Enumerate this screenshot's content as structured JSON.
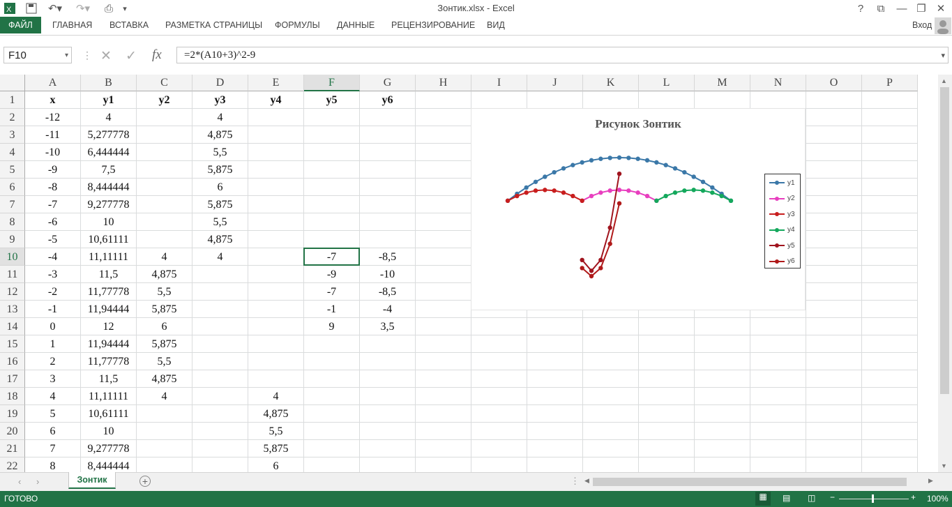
{
  "window": {
    "title": "Зонтик.xlsx - Excel",
    "help": "?",
    "controls": [
      "⧉",
      "—",
      "❐",
      "✕"
    ]
  },
  "ribbon": {
    "file_tab": "ФАЙЛ",
    "tabs": [
      "ГЛАВНАЯ",
      "ВСТАВКА",
      "РАЗМЕТКА СТРАНИЦЫ",
      "ФОРМУЛЫ",
      "ДАННЫЕ",
      "РЕЦЕНЗИРОВАНИЕ",
      "ВИД"
    ],
    "signin": "Вход"
  },
  "formula_bar": {
    "name_box": "F10",
    "formula": "=2*(A10+3)^2-9",
    "fx_label": "fx"
  },
  "sheet": {
    "columns": [
      "A",
      "B",
      "C",
      "D",
      "E",
      "F",
      "G",
      "H",
      "I",
      "J",
      "K",
      "L",
      "M",
      "N",
      "O",
      "P"
    ],
    "selected_cell": "F10",
    "rows": [
      {
        "n": "1",
        "c": [
          "x",
          "y1",
          "y2",
          "y3",
          "y4",
          "y5",
          "y6"
        ]
      },
      {
        "n": "2",
        "c": [
          "-12",
          "4",
          "",
          "4",
          "",
          "",
          ""
        ]
      },
      {
        "n": "3",
        "c": [
          "-11",
          "5,277778",
          "",
          "4,875",
          "",
          "",
          ""
        ]
      },
      {
        "n": "4",
        "c": [
          "-10",
          "6,444444",
          "",
          "5,5",
          "",
          "",
          ""
        ]
      },
      {
        "n": "5",
        "c": [
          "-9",
          "7,5",
          "",
          "5,875",
          "",
          "",
          ""
        ]
      },
      {
        "n": "6",
        "c": [
          "-8",
          "8,444444",
          "",
          "6",
          "",
          "",
          ""
        ]
      },
      {
        "n": "7",
        "c": [
          "-7",
          "9,277778",
          "",
          "5,875",
          "",
          "",
          ""
        ]
      },
      {
        "n": "8",
        "c": [
          "-6",
          "10",
          "",
          "5,5",
          "",
          "",
          ""
        ]
      },
      {
        "n": "9",
        "c": [
          "-5",
          "10,61111",
          "",
          "4,875",
          "",
          "",
          ""
        ]
      },
      {
        "n": "10",
        "c": [
          "-4",
          "11,11111",
          "4",
          "4",
          "",
          "-7",
          "-8,5"
        ]
      },
      {
        "n": "11",
        "c": [
          "-3",
          "11,5",
          "4,875",
          "",
          "",
          "-9",
          "-10"
        ]
      },
      {
        "n": "12",
        "c": [
          "-2",
          "11,77778",
          "5,5",
          "",
          "",
          "-7",
          "-8,5"
        ]
      },
      {
        "n": "13",
        "c": [
          "-1",
          "11,94444",
          "5,875",
          "",
          "",
          "-1",
          "-4"
        ]
      },
      {
        "n": "14",
        "c": [
          "0",
          "12",
          "6",
          "",
          "",
          "9",
          "3,5"
        ]
      },
      {
        "n": "15",
        "c": [
          "1",
          "11,94444",
          "5,875",
          "",
          "",
          "",
          ""
        ]
      },
      {
        "n": "16",
        "c": [
          "2",
          "11,77778",
          "5,5",
          "",
          "",
          "",
          ""
        ]
      },
      {
        "n": "17",
        "c": [
          "3",
          "11,5",
          "4,875",
          "",
          "",
          "",
          ""
        ]
      },
      {
        "n": "18",
        "c": [
          "4",
          "11,11111",
          "4",
          "",
          "4",
          "",
          ""
        ]
      },
      {
        "n": "19",
        "c": [
          "5",
          "10,61111",
          "",
          "",
          "4,875",
          "",
          ""
        ]
      },
      {
        "n": "20",
        "c": [
          "6",
          "10",
          "",
          "",
          "5,5",
          "",
          ""
        ]
      },
      {
        "n": "21",
        "c": [
          "7",
          "9,277778",
          "",
          "",
          "5,875",
          "",
          ""
        ]
      },
      {
        "n": "22",
        "c": [
          "8",
          "8,444444",
          "",
          "",
          "6",
          "",
          ""
        ]
      }
    ]
  },
  "chart_data": {
    "type": "scatter",
    "title": "Рисунок   Зонтик",
    "legend_position": "right",
    "xlim": [
      -12,
      12
    ],
    "ylim": [
      -10,
      12
    ],
    "series": [
      {
        "name": "y1",
        "color": "#3b78a8",
        "x": [
          -12,
          -11,
          -10,
          -9,
          -8,
          -7,
          -6,
          -5,
          -4,
          -3,
          -2,
          -1,
          0,
          1,
          2,
          3,
          4,
          5,
          6,
          7,
          8,
          9,
          10,
          11,
          12
        ],
        "y": [
          4,
          5.277778,
          6.444444,
          7.5,
          8.444444,
          9.277778,
          10,
          10.61111,
          11.11111,
          11.5,
          11.77778,
          11.94444,
          12,
          11.94444,
          11.77778,
          11.5,
          11.11111,
          10.61111,
          10,
          9.277778,
          8.444444,
          7.5,
          6.444444,
          5.277778,
          4
        ]
      },
      {
        "name": "y2",
        "color": "#e83fbf",
        "x": [
          -4,
          -3,
          -2,
          -1,
          0,
          1,
          2,
          3,
          4
        ],
        "y": [
          4,
          4.875,
          5.5,
          5.875,
          6,
          5.875,
          5.5,
          4.875,
          4
        ]
      },
      {
        "name": "y3",
        "color": "#c81e1e",
        "x": [
          -12,
          -11,
          -10,
          -9,
          -8,
          -7,
          -6,
          -5,
          -4
        ],
        "y": [
          4,
          4.875,
          5.5,
          5.875,
          6,
          5.875,
          5.5,
          4.875,
          4
        ]
      },
      {
        "name": "y4",
        "color": "#14a85c",
        "x": [
          4,
          5,
          6,
          7,
          8,
          9,
          10,
          11,
          12
        ],
        "y": [
          4,
          4.875,
          5.5,
          5.875,
          6,
          5.875,
          5.5,
          4.875,
          4
        ]
      },
      {
        "name": "y5",
        "color": "#a0141e",
        "x": [
          -4,
          -3,
          -2,
          -1,
          0
        ],
        "y": [
          -7,
          -9,
          -7,
          -1,
          9
        ]
      },
      {
        "name": "y6",
        "color": "#b01a1a",
        "x": [
          -4,
          -3,
          -2,
          -1,
          0
        ],
        "y": [
          -8.5,
          -10,
          -8.5,
          -4,
          3.5
        ]
      }
    ]
  },
  "sheet_tabs": {
    "active": "Зонтик",
    "add": "+"
  },
  "status": {
    "text": "ГОТОВО",
    "zoom": "100%"
  }
}
